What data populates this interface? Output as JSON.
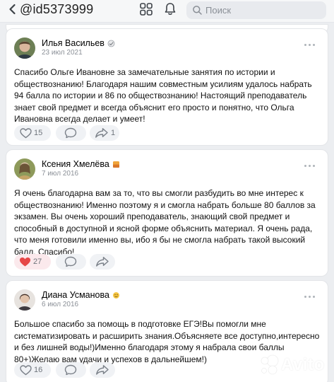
{
  "header": {
    "username": "@id5373999",
    "search_placeholder": "Поиск"
  },
  "reviews": [
    {
      "author": "Илья Васильев",
      "date": "23 июл 2021",
      "text": "Спасибо Ольге Ивановне за замечательные занятия по истории и обществознанию! Благодаря нашим совместным усилиям удалось набрать 94 балла по истории и 86 по обществознанию! Настоящий преподаватель знает свой предмет и всегда объяснит его просто и понятно, что Ольга Ивановна всегда делает и умеет!",
      "likes": "15",
      "comments": "",
      "shares": "1",
      "liked": false
    },
    {
      "author": "Ксения Хмелёва",
      "date": "7 июл 2016",
      "text": "Я очень благодарна вам за то, что вы смогли разбудить во мне интерес к обществознанию! Именно поэтому я и смогла набрать больше 80 баллов за экзамен. Вы очень хороший преподаватель, знающий свой предмет и способный в доступной и ясной форме объяснить материал. Я очень рада, что меня готовили именно вы, ибо я бы не смогла набрать такой высокий балл. Спасибо!",
      "likes": "27",
      "comments": "",
      "shares": "",
      "liked": true
    },
    {
      "author": "Диана Усманова",
      "date": "6 июл 2016",
      "text": "Большое спасибо за помощь в подготовке ЕГЭ!Вы помогли мне систематизировать и расширить знания.Объясняете все доступно,интересно и без лишней воды!)Именно благодаря этому я набрала свои баллы 80+)Желаю вам удачи и успехов в дальнейшем!)",
      "likes": "16",
      "comments": "",
      "shares": "",
      "liked": false
    }
  ],
  "watermark": "Avito",
  "colors": {
    "background": "#eceef1",
    "card": "#ffffff",
    "liked_heart": "#e64646",
    "muted": "#8b9097"
  }
}
